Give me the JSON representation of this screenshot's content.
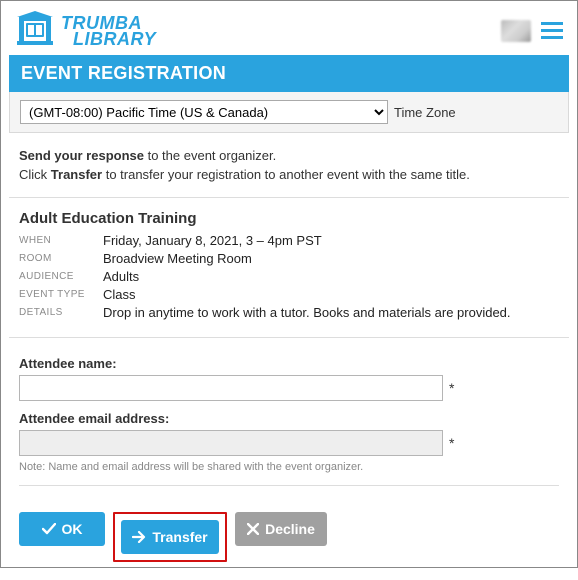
{
  "brand": {
    "line1": "TRUMBA",
    "line2": "LIBRARY"
  },
  "page_title": "EVENT REGISTRATION",
  "timezone": {
    "selected": "(GMT-08:00) Pacific Time (US & Canada)",
    "label": "Time Zone"
  },
  "instructions": {
    "line1_a": "Send your response",
    "line1_b": " to the event organizer.",
    "line2_a": "Click ",
    "line2_b": "Transfer",
    "line2_c": " to transfer your registration to another event with the same title."
  },
  "event": {
    "title": "Adult Education Training",
    "fields": {
      "when": {
        "label": "WHEN",
        "value": "Friday, January 8, 2021, 3 – 4pm PST"
      },
      "room": {
        "label": "ROOM",
        "value": "Broadview Meeting Room"
      },
      "audience": {
        "label": "AUDIENCE",
        "value": "Adults"
      },
      "event_type": {
        "label": "EVENT TYPE",
        "value": "Class"
      },
      "details": {
        "label": "DETAILS",
        "value": "Drop in anytime to work with a tutor. Books and materials are provided."
      }
    }
  },
  "form": {
    "name_label": "Attendee name:",
    "name_value": "",
    "email_label": "Attendee email address:",
    "email_value": "",
    "required_mark": "*",
    "note": "Note: Name and email address will be shared with the event organizer."
  },
  "buttons": {
    "ok": "OK",
    "transfer": "Transfer",
    "decline": "Decline"
  }
}
